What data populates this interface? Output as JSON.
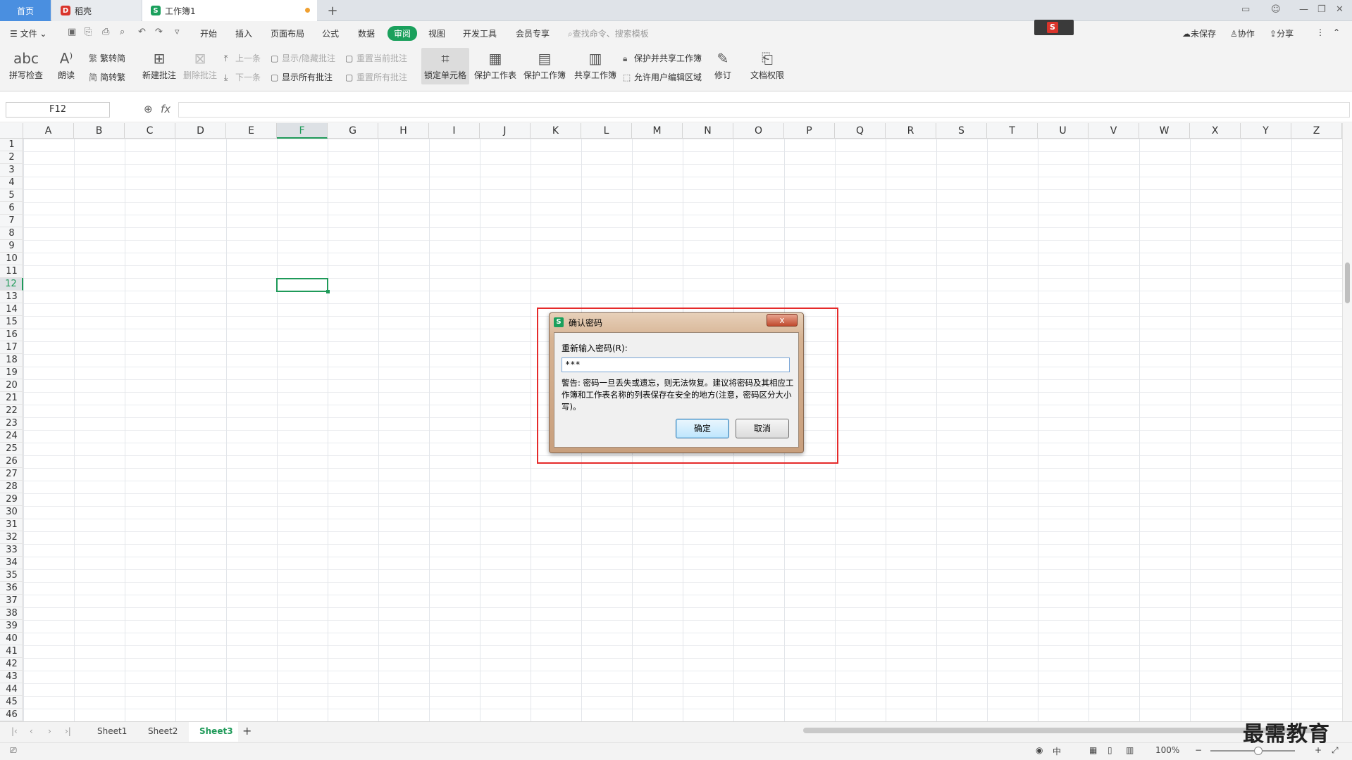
{
  "tabs": {
    "home": "首页",
    "daoke": "稻壳",
    "book": "工作簿1",
    "add": "+"
  },
  "menu": {
    "file": "文件",
    "items": [
      "开始",
      "插入",
      "页面布局",
      "公式",
      "数据",
      "审阅",
      "视图",
      "开发工具",
      "会员专享"
    ],
    "search": "查找命令、搜索模板",
    "unsaved": "未保存",
    "collab": "协作",
    "share": "分享"
  },
  "ribbon": {
    "spell": "拼写检查",
    "read": "朗读",
    "trad2simp": "繁转简",
    "simp2trad": "简转繁",
    "new_comment": "新建批注",
    "del_comment": "删除批注",
    "prev": "上一条",
    "next": "下一条",
    "show_hide": "显示/隐藏批注",
    "show_all": "显示所有批注",
    "reset_cur": "重置当前批注",
    "reset_all": "重置所有批注",
    "lock_cell": "锁定单元格",
    "protect_sheet": "保护工作表",
    "protect_book": "保护工作簿",
    "share_book": "共享工作簿",
    "protect_share": "保护并共享工作簿",
    "allow_edit": "允许用户编辑区域",
    "revise": "修订",
    "doc_rights": "文档权限"
  },
  "formula": {
    "namebox": "F12",
    "fx": "fx"
  },
  "columns": [
    "A",
    "B",
    "C",
    "D",
    "E",
    "F",
    "G",
    "H",
    "I",
    "J",
    "K",
    "L",
    "M",
    "N",
    "O",
    "P",
    "Q",
    "R",
    "S",
    "T",
    "U",
    "V",
    "W",
    "X",
    "Y",
    "Z"
  ],
  "rows": [
    "1",
    "2",
    "3",
    "4",
    "5",
    "6",
    "7",
    "8",
    "9",
    "10",
    "11",
    "12",
    "13",
    "14",
    "15",
    "16",
    "17",
    "18",
    "19",
    "20",
    "21",
    "22",
    "23",
    "24",
    "25",
    "26",
    "27",
    "28",
    "29",
    "30",
    "31",
    "32",
    "33",
    "34",
    "35",
    "36",
    "37",
    "38",
    "39",
    "40",
    "41",
    "42",
    "43",
    "44",
    "45",
    "46"
  ],
  "selected": {
    "col": "F",
    "row": "12"
  },
  "sheets": [
    "Sheet1",
    "Sheet2",
    "Sheet3"
  ],
  "status": {
    "zoom": "100%"
  },
  "watermark": "最需教育",
  "dialog": {
    "title": "确认密码",
    "close": "x",
    "label": "重新输入密码(R):",
    "value": "***",
    "warning": "警告: 密码一旦丢失或遗忘，则无法恢复。建议将密码及其相应工作簿和工作表名称的列表保存在安全的地方(注意，密码区分大小写)。",
    "ok": "确定",
    "cancel": "取消"
  },
  "colors": {
    "accent": "#1aa05c",
    "home_tab": "#4a8fe0",
    "highlight": "#e52a2a"
  }
}
